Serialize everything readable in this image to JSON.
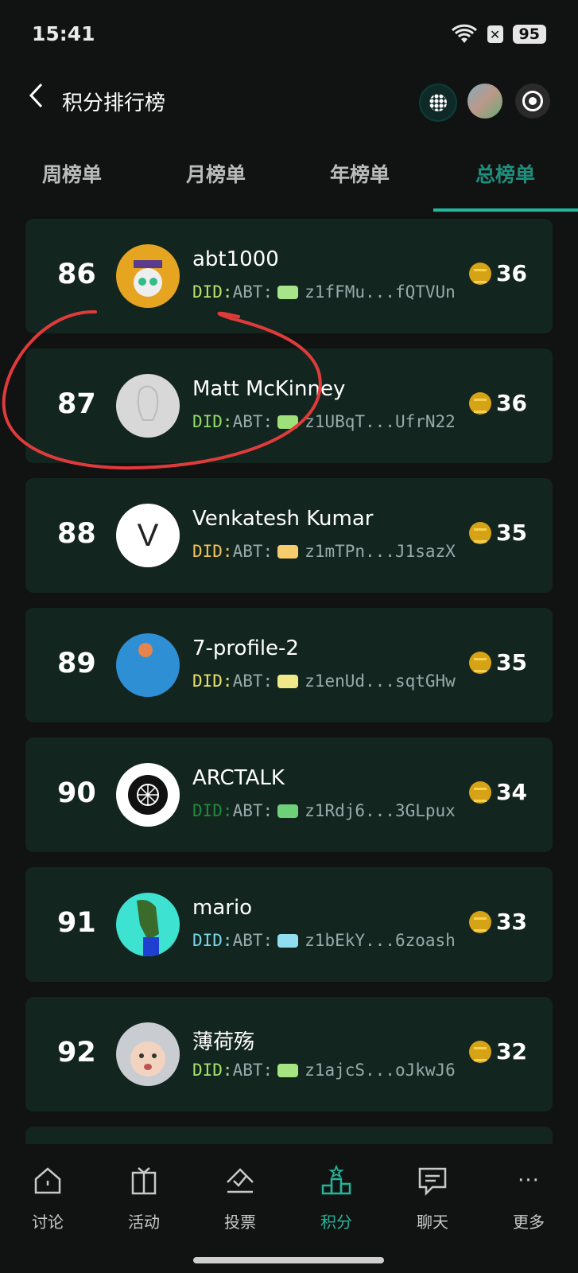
{
  "status_bar": {
    "time": "15:41",
    "battery": "95"
  },
  "header": {
    "title": "积分排行榜"
  },
  "tabs": [
    {
      "label": "周榜单",
      "active": false
    },
    {
      "label": "月榜单",
      "active": false
    },
    {
      "label": "年榜单",
      "active": false
    },
    {
      "label": "总榜单",
      "active": true
    }
  ],
  "entries": [
    {
      "rank": "86",
      "name": "abt1000",
      "did_prefix": "DID:",
      "did_method": "ABT:",
      "did_value": "z1fFMu...fQTVUn",
      "score": "36",
      "prefix_color": "#b6e36b",
      "chip_color": "#a8e58a"
    },
    {
      "rank": "87",
      "name": "Matt McKinney",
      "did_prefix": "DID:",
      "did_method": "ABT:",
      "did_value": "z1UBqT...UfrN22",
      "score": "36",
      "prefix_color": "#8fdc6a",
      "chip_color": "#9ee07a"
    },
    {
      "rank": "88",
      "name": "Venkatesh Kumar",
      "did_prefix": "DID:",
      "did_method": "ABT:",
      "did_value": "z1mTPn...J1sazX",
      "score": "35",
      "prefix_color": "#f2c25a",
      "chip_color": "#f5cd6e"
    },
    {
      "rank": "89",
      "name": "7-profile-2",
      "did_prefix": "DID:",
      "did_method": "ABT:",
      "did_value": "z1enUd...sqtGHw",
      "score": "35",
      "prefix_color": "#e8e36a",
      "chip_color": "#f0e98a"
    },
    {
      "rank": "90",
      "name": "ARCTALK",
      "did_prefix": "DID:",
      "did_method": "ABT:",
      "did_value": "z1Rdj6...3GLpux",
      "score": "34",
      "prefix_color": "#1f8a3a",
      "chip_color": "#6fd07a"
    },
    {
      "rank": "91",
      "name": "mario",
      "did_prefix": "DID:",
      "did_method": "ABT:",
      "did_value": "z1bEkY...6zoash",
      "score": "33",
      "prefix_color": "#7ad6e8",
      "chip_color": "#8fdff0"
    },
    {
      "rank": "92",
      "name": "薄荷殇",
      "did_prefix": "DID:",
      "did_method": "ABT:",
      "did_value": "z1ajcS...oJkwJ6",
      "score": "32",
      "prefix_color": "#a4e36b",
      "chip_color": "#a6e482"
    }
  ],
  "avatar_88_letter": "V",
  "bottom_nav": [
    {
      "label": "讨论",
      "icon": "home-icon",
      "active": false
    },
    {
      "label": "活动",
      "icon": "gift-icon",
      "active": false
    },
    {
      "label": "投票",
      "icon": "vote-icon",
      "active": false
    },
    {
      "label": "积分",
      "icon": "podium-icon",
      "active": true
    },
    {
      "label": "聊天",
      "icon": "chat-icon",
      "active": false
    },
    {
      "label": "更多",
      "icon": "more-icon",
      "active": false
    }
  ],
  "colors": {
    "accent": "#1fb9a0",
    "card_bg": "#13251f",
    "annotation": "#e03b3b"
  }
}
